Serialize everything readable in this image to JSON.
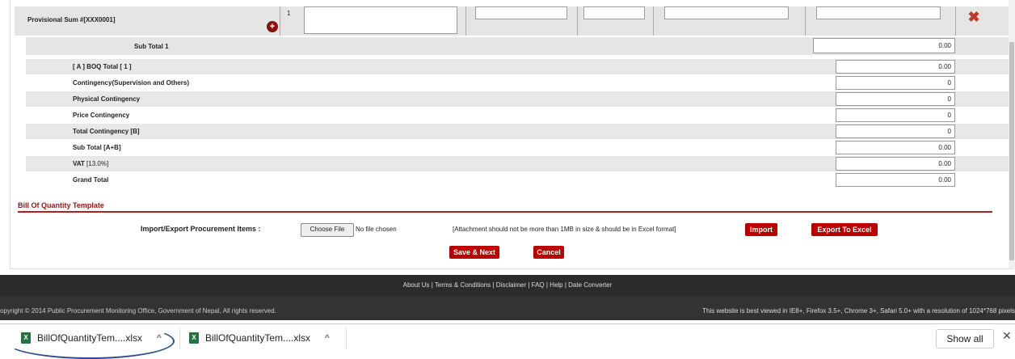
{
  "top_row": {
    "provisional_label": "Provisional Sum #[XXX0001]",
    "line_number": "1"
  },
  "subtotal1": {
    "label": "Sub Total 1",
    "value": "0.00"
  },
  "summary_rows": [
    {
      "label": "[ A ] BOQ Total [ 1 ]",
      "value": "0.00"
    },
    {
      "label": "Contingency(Supervision and Others)",
      "value": "0"
    },
    {
      "label": "Physical Contingency",
      "value": "0"
    },
    {
      "label": "Price Contingency",
      "value": "0"
    },
    {
      "label": "Total Contingency [B]",
      "value": "0"
    },
    {
      "label": "Sub Total [A+B]",
      "value": "0.00"
    },
    {
      "label": "VAT",
      "suffix": "[13.0%]",
      "value": "0.00"
    },
    {
      "label": "Grand Total",
      "value": "0.00"
    }
  ],
  "boq_template": {
    "header": "Bill Of Quantity Template",
    "import_label": "Import/Export Procurement Items :",
    "choose_file": "Choose File",
    "no_file": "No file chosen",
    "attachment_note": "[Attachment should not be more than 1MB in size & should be in Excel format]",
    "import_button": "Import",
    "export_button": "Export To Excel",
    "save_next_button": "Save & Next",
    "cancel_button": "Cancel"
  },
  "footer": {
    "links": "About Us | Terms & Conditions | Disclaimer | FAQ | Help | Date Converter",
    "copyright": "opyright © 2014 Public Procurement Monitoring Office, Government of Nepal, All rights reserved.",
    "best_viewed": "This website is best viewed in IE8+, Firefox 3.5+, Chrome 3+, Safari 5.0+ with a resolution of 1024*768 pixels"
  },
  "downloads": {
    "items": [
      {
        "name": "BillOfQuantityTem....xlsx",
        "icon": "excel-file-icon"
      },
      {
        "name": "BillOfQuantityTem....xlsx",
        "icon": "excel-file-icon"
      }
    ],
    "show_all": "Show all",
    "icon_glyph": "X",
    "chevron_glyph": "^",
    "close_glyph": "✕"
  },
  "colors": {
    "accent_red": "#b00000",
    "header_red": "#8b1a1a",
    "footer_dark": "#2b2b2b"
  }
}
